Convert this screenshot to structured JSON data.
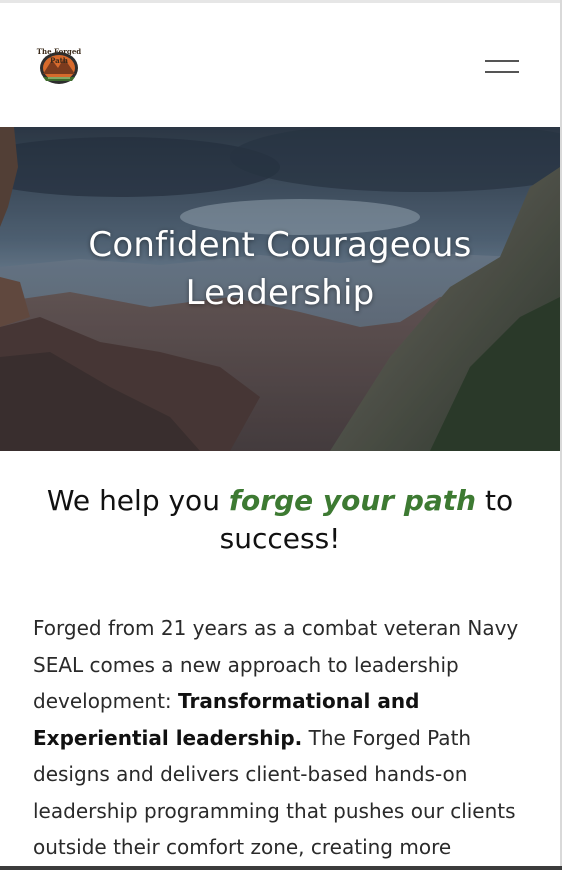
{
  "header": {
    "logo_text": "The Forged Path",
    "menu_icon": "hamburger-icon"
  },
  "hero": {
    "title_line1": "Confident Courageous",
    "title_line2": "Leadership"
  },
  "tagline": {
    "part1": "We help you ",
    "emphasis": "forge your path",
    "part2": " to success!",
    "emphasis_color": "#3d7a32"
  },
  "intro": {
    "text1": "Forged from 21 years as a combat veteran Navy SEAL comes a new approach to leadership development: ",
    "bold": "Transformational and Experiential leadership.",
    "text2": " The Forged Path designs and delivers client-based hands-on leadership programming that pushes our clients outside their comfort zone, creating more"
  }
}
